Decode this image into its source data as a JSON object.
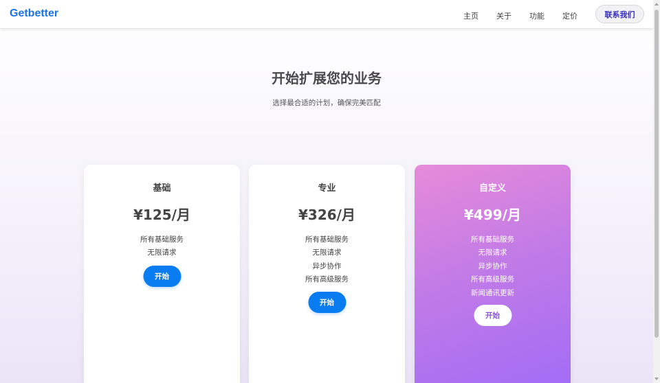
{
  "navbar": {
    "logo": "Getbetter",
    "links": [
      "主页",
      "关于",
      "功能",
      "定价"
    ],
    "contact_label": "联系我们"
  },
  "hero": {
    "title": "开始扩展您的业务",
    "subtitle": "选择最合适的计划，确保完美匹配"
  },
  "plans": [
    {
      "name": "基础",
      "price": "¥125/月",
      "features": [
        "所有基础服务",
        "无限请求"
      ],
      "button": "开始",
      "featured": false
    },
    {
      "name": "专业",
      "price": "¥326/月",
      "features": [
        "所有基础服务",
        "无限请求",
        "异步协作",
        "所有高级服务"
      ],
      "button": "开始",
      "featured": false
    },
    {
      "name": "自定义",
      "price": "¥499/月",
      "features": [
        "所有基础服务",
        "无限请求",
        "异步协作",
        "所有高级服务",
        "新闻通讯更新"
      ],
      "button": "开始",
      "featured": true
    }
  ],
  "colors": {
    "brand": "#1a73e8",
    "button_primary": "#0a7cf2",
    "featured_gradient_start": "#e78bd9",
    "featured_gradient_end": "#a16cf6",
    "contact_text": "#3a2fbf"
  }
}
